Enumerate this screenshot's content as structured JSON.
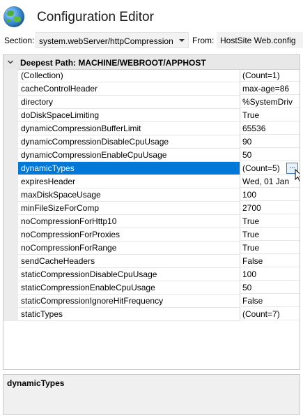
{
  "header": {
    "title": "Configuration Editor",
    "icon": "globe-icon"
  },
  "section": {
    "label": "Section:",
    "value": "system.webServer/httpCompression"
  },
  "from": {
    "label": "From:",
    "value": "HostSite Web.config"
  },
  "grid": {
    "header": "Deepest Path: MACHINE/WEBROOT/APPHOST",
    "selected_index": 7,
    "rows": [
      {
        "name": "(Collection)",
        "value": "(Count=1)"
      },
      {
        "name": "cacheControlHeader",
        "value": "max-age=86"
      },
      {
        "name": "directory",
        "value": "%SystemDriv"
      },
      {
        "name": "doDiskSpaceLimiting",
        "value": "True"
      },
      {
        "name": "dynamicCompressionBufferLimit",
        "value": "65536"
      },
      {
        "name": "dynamicCompressionDisableCpuUsage",
        "value": "90"
      },
      {
        "name": "dynamicCompressionEnableCpuUsage",
        "value": "50"
      },
      {
        "name": "dynamicTypes",
        "value": "(Count=5)"
      },
      {
        "name": "expiresHeader",
        "value": "Wed, 01 Jan"
      },
      {
        "name": "maxDiskSpaceUsage",
        "value": "100"
      },
      {
        "name": "minFileSizeForComp",
        "value": "2700"
      },
      {
        "name": "noCompressionForHttp10",
        "value": "True"
      },
      {
        "name": "noCompressionForProxies",
        "value": "True"
      },
      {
        "name": "noCompressionForRange",
        "value": "True"
      },
      {
        "name": "sendCacheHeaders",
        "value": "False"
      },
      {
        "name": "staticCompressionDisableCpuUsage",
        "value": "100"
      },
      {
        "name": "staticCompressionEnableCpuUsage",
        "value": "50"
      },
      {
        "name": "staticCompressionIgnoreHitFrequency",
        "value": "False"
      },
      {
        "name": "staticTypes",
        "value": "(Count=7)"
      }
    ],
    "ellipsis_label": "..."
  },
  "description": {
    "title": "dynamicTypes"
  },
  "colors": {
    "selection": "#0078d7",
    "accent_border": "#3c7fb1"
  }
}
